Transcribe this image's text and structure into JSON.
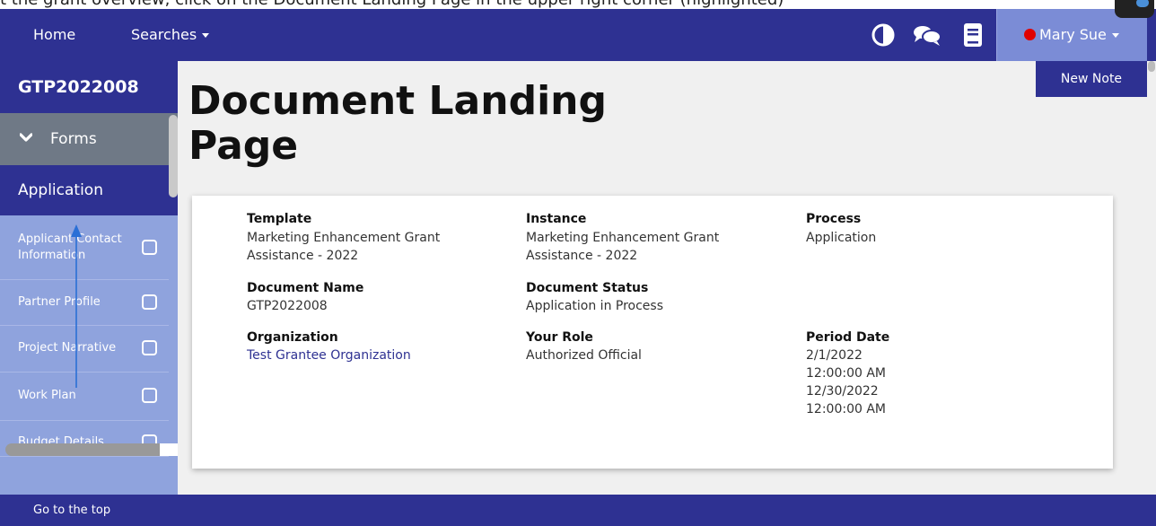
{
  "top_caption": "t the grant overview, click on the Document Landing Page in the upper right corner (highlighted)",
  "navbar": {
    "home_label": "Home",
    "searches_label": "Searches",
    "user_name": "Mary Sue",
    "icons": [
      "contrast-icon",
      "chat-icon",
      "book-icon"
    ]
  },
  "sidebar": {
    "document_code": "GTP2022008",
    "forms_label": "Forms",
    "application_label": "Application",
    "items": [
      {
        "label": "Applicant Contact Information"
      },
      {
        "label": "Partner Profile"
      },
      {
        "label": "Project Narrative"
      },
      {
        "label": "Work Plan"
      },
      {
        "label": "Budget Details"
      }
    ]
  },
  "main": {
    "title": "Document Landing Page",
    "new_note_label": "New Note"
  },
  "card": {
    "template_label": "Template",
    "template_value": "Marketing Enhancement Grant Assistance - 2022",
    "instance_label": "Instance",
    "instance_value": "Marketing Enhancement Grant Assistance - 2022",
    "process_label": "Process",
    "process_value": "Application",
    "document_name_label": "Document Name",
    "document_name_value": "GTP2022008",
    "document_status_label": "Document Status",
    "document_status_value": "Application in Process",
    "organization_label": "Organization",
    "organization_value": "Test Grantee Organization",
    "your_role_label": "Your Role",
    "your_role_value": "Authorized Official",
    "period_date_label": "Period Date",
    "period_start_date": "2/1/2022",
    "period_start_time": "12:00:00 AM",
    "period_end_date": "12/30/2022",
    "period_end_time": "12:00:00 AM"
  },
  "footer": {
    "go_top_label": "Go to the top"
  },
  "colors": {
    "navbar": "#2e3192",
    "sidebar": "#8fa3dd",
    "forms_bar": "#6f7986",
    "user_box": "#7b8cd6",
    "status_dot": "#e00000",
    "link": "#2e3192"
  }
}
